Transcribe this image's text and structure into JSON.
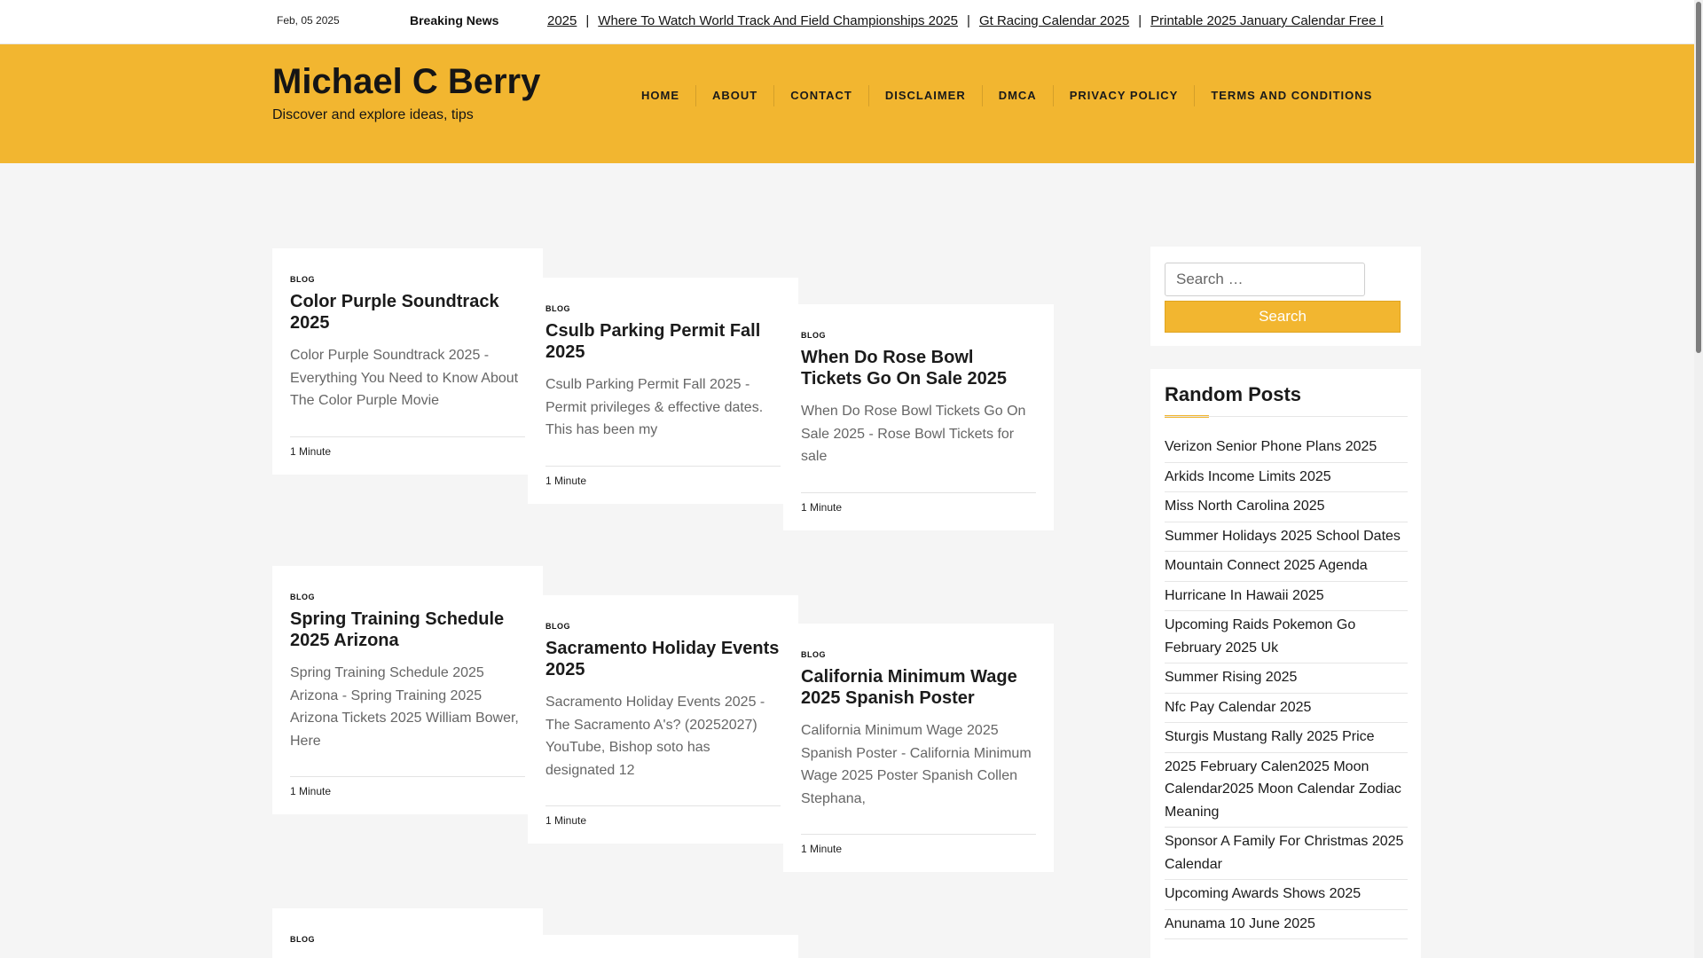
{
  "topbar": {
    "date": "Feb, 05 2025",
    "breaking_label": "Breaking News",
    "ticker": [
      "2025",
      "Where To Watch World Track And Field Championships 2025",
      "Gt Racing Calendar 2025",
      "Printable 2025 January Calendar Free I"
    ],
    "separator": "|"
  },
  "header": {
    "site_title": "Michael C Berry",
    "tagline": "Discover and explore ideas, tips",
    "nav": [
      "HOME",
      "ABOUT",
      "CONTACT",
      "DISCLAIMER",
      "DMCA",
      "PRIVACY POLICY",
      "TERMS AND CONDITIONS"
    ]
  },
  "posts": [
    {
      "category": "BLOG",
      "title": "Color Purple Soundtrack 2025",
      "excerpt": "Color Purple Soundtrack 2025 - Everything You Need to Know About The Color Purple Movie",
      "read_time": "1 Minute"
    },
    {
      "category": "BLOG",
      "title": "Csulb Parking Permit Fall 2025",
      "excerpt": "Csulb Parking Permit Fall 2025 - Permit privileges & effective dates. This has been my",
      "read_time": "1 Minute"
    },
    {
      "category": "BLOG",
      "title": "When Do Rose Bowl Tickets Go On Sale 2025",
      "excerpt": "When Do Rose Bowl Tickets Go On Sale 2025 - Rose Bowl Tickets for sale",
      "read_time": "1 Minute"
    },
    {
      "category": "BLOG",
      "title": "Spring Training Schedule 2025 Arizona",
      "excerpt": "Spring Training Schedule 2025 Arizona - Spring Training 2025 Arizona Tickets 2025 William Bower, Here",
      "read_time": "1 Minute"
    },
    {
      "category": "BLOG",
      "title": "Sacramento Holiday Events 2025",
      "excerpt": "Sacramento Holiday Events 2025 - The Sacramento A's? (20252027) YouTube, Bishop soto has designated 12",
      "read_time": "1 Minute"
    },
    {
      "category": "BLOG",
      "title": "California Minimum Wage 2025 Spanish Poster",
      "excerpt": "California Minimum Wage 2025 Spanish Poster - California Minimum Wage 2025 Poster Spanish Collen Stephana,",
      "read_time": "1 Minute"
    },
    {
      "category": "BLOG"
    }
  ],
  "sidebar": {
    "search_placeholder": "Search …",
    "search_button": "Search",
    "random_title": "Random Posts",
    "random_posts": [
      "Verizon Senior Phone Plans 2025",
      "Arkids Income Limits 2025",
      "Miss North Carolina 2025",
      "Summer Holidays 2025 School Dates",
      "Mountain Connect 2025 Agenda",
      "Hurricane In Hawaii 2025",
      "Upcoming Raids Pokemon Go February 2025 Uk",
      "Summer Rising 2025",
      "Nfc Pay Calendar 2025",
      "Sturgis Mustang Rally 2025 Price",
      "2025 February Calen2025 Moon Calendar2025 Moon Calendar Zodiac Meaning",
      "Sponsor A Family For Christmas 2025 Calendar",
      "Upcoming Awards Shows 2025",
      "Anunama 10 June 2025"
    ]
  },
  "colors": {
    "accent": "#f2b630",
    "background": "#f5f5f5",
    "card": "#ffffff"
  }
}
